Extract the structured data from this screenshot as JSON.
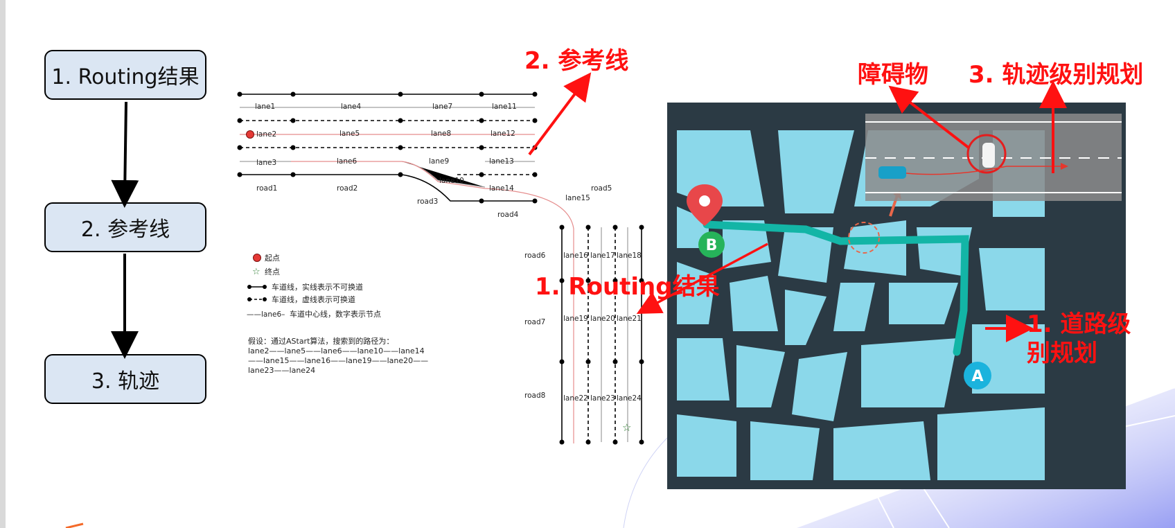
{
  "flowchart": {
    "steps": [
      "1. Routing结果",
      "2. 参考线",
      "3. 轨迹"
    ]
  },
  "lane_diagram": {
    "lanes_top": [
      "lane1",
      "lane4",
      "lane7",
      "lane11"
    ],
    "lanes_row2": [
      "lane2",
      "lane5",
      "lane8",
      "lane12"
    ],
    "lanes_row3": [
      "lane3",
      "lane6",
      "lane9",
      "lane13"
    ],
    "lane10": "lane10",
    "lane14": "lane14",
    "lane15": "lane15",
    "roads": {
      "road1": "road1",
      "road2": "road2",
      "road3": "road3",
      "road4": "road4",
      "road5": "road5",
      "road6": "road6",
      "road7": "road7",
      "road8": "road8"
    },
    "vertical_lanes": {
      "row1": [
        "lane16",
        "lane17",
        "lane18"
      ],
      "row2": [
        "lane19",
        "lane20",
        "lane21"
      ],
      "row3": [
        "lane22",
        "lane23",
        "lane24"
      ]
    },
    "legend": {
      "start": "起点",
      "end": "终点",
      "solid": "车道线，实线表示不可换道",
      "dashed": "车道线，虚线表示可换道",
      "center": "车道中心线，数字表示节点",
      "center_sample": "——lane6–"
    },
    "assumption": [
      "假设：通过AStart算法，搜索到的路径为：",
      "lane2——lane5——lane6——lane10——lane14",
      "——lane15——lane16——lane19——lane20——",
      "lane23——lane24"
    ]
  },
  "annotations": {
    "ref_line": "2. 参考线",
    "routing": "1. Routing结果",
    "obstacle": "障碍物",
    "trajectory": "3. 轨迹级别规划",
    "road_level_1": "1. 道路级",
    "road_level_2": "别规划"
  },
  "map": {
    "marker_a": "A",
    "marker_b": "B"
  },
  "colors": {
    "annotation_red": "#ff1111",
    "box_fill": "#dbe6f3",
    "map_dark": "#2b3a44",
    "map_block": "#8bd8ea",
    "route": "#13b5a6"
  }
}
